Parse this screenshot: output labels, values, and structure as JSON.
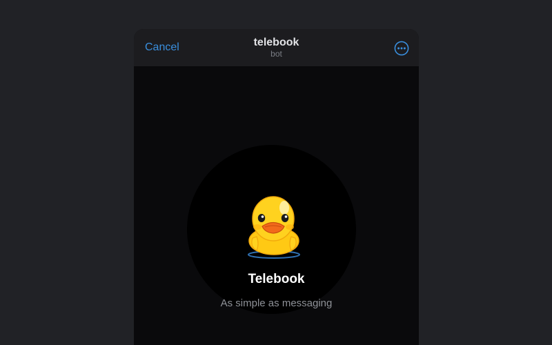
{
  "header": {
    "cancel_label": "Cancel",
    "title": "telebook",
    "subtitle": "bot",
    "more_icon": "more-horizontal-circle-icon"
  },
  "splash": {
    "mascot_icon": "duck-mascot",
    "app_name": "Telebook",
    "tagline": "As simple as messaging"
  },
  "colors": {
    "background": "#212226",
    "panel": "#0a0a0c",
    "header": "#1c1c1f",
    "accent": "#3a8fde",
    "circle": "#000000",
    "duck_yellow": "#ffd21f",
    "beak_orange": "#f26a1b"
  }
}
